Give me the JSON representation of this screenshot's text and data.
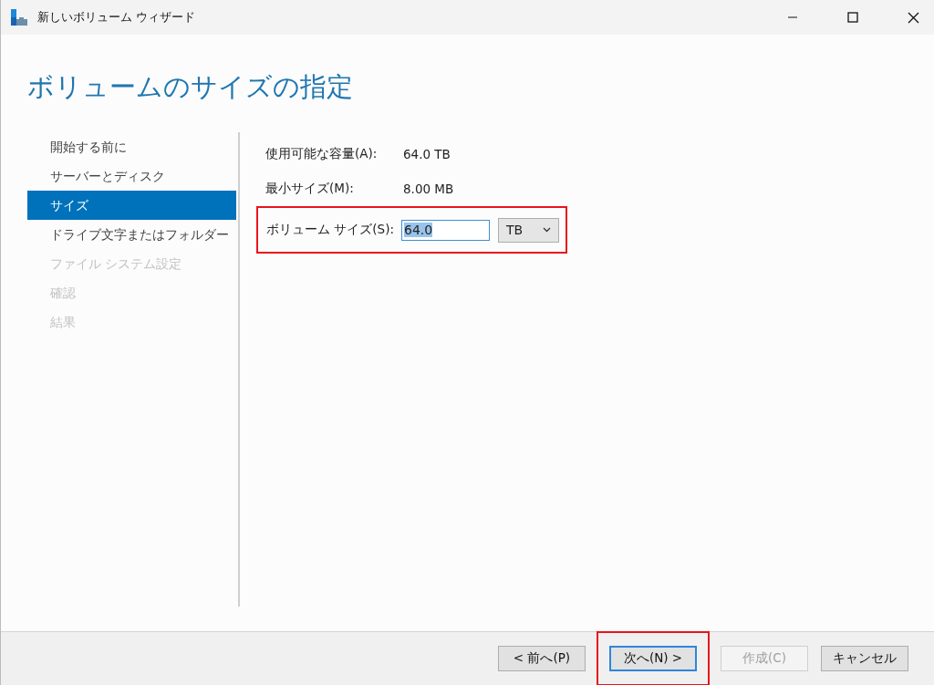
{
  "window": {
    "title": "新しいボリューム ウィザード"
  },
  "heading": "ボリュームのサイズの指定",
  "steps": [
    {
      "label": "開始する前に",
      "selected": false,
      "disabled": false
    },
    {
      "label": "サーバーとディスク",
      "selected": false,
      "disabled": false
    },
    {
      "label": "サイズ",
      "selected": true,
      "disabled": false
    },
    {
      "label": "ドライブ文字またはフォルダー",
      "selected": false,
      "disabled": false
    },
    {
      "label": "ファイル システム設定",
      "selected": false,
      "disabled": true
    },
    {
      "label": "確認",
      "selected": false,
      "disabled": true
    },
    {
      "label": "結果",
      "selected": false,
      "disabled": true
    }
  ],
  "info": [
    {
      "label": "使用可能な容量(A):",
      "value": "64.0 TB"
    },
    {
      "label": "最小サイズ(M):",
      "value": "8.00 MB"
    }
  ],
  "size_field": {
    "label": "ボリューム サイズ(S):",
    "value": "64.0",
    "text_selected": true,
    "unit": "TB",
    "highlighted": true
  },
  "buttons": [
    {
      "label": "< 前へ(P)",
      "disabled": false,
      "focused": false,
      "highlighted": false
    },
    {
      "label": "次へ(N) >",
      "disabled": false,
      "focused": true,
      "highlighted": true
    },
    {
      "label": "作成(C)",
      "disabled": true,
      "focused": false,
      "highlighted": false
    },
    {
      "label": "キャンセル",
      "disabled": false,
      "focused": false,
      "highlighted": false
    }
  ]
}
